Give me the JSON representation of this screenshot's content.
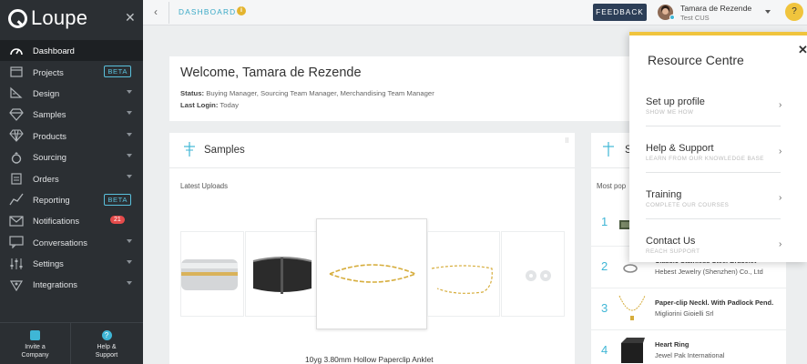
{
  "app": {
    "logo_text": "Loupe"
  },
  "sidebar": {
    "items": [
      {
        "label": "Dashboard",
        "icon": "dashboard-gauge-icon",
        "active": true
      },
      {
        "label": "Projects",
        "icon": "projects-icon",
        "badge": "BETA"
      },
      {
        "label": "Design",
        "icon": "design-ruler-icon"
      },
      {
        "label": "Samples",
        "icon": "diamond-icon"
      },
      {
        "label": "Products",
        "icon": "gem-icon"
      },
      {
        "label": "Sourcing",
        "icon": "ring-icon"
      },
      {
        "label": "Orders",
        "icon": "clipboard-icon"
      },
      {
        "label": "Reporting",
        "icon": "chart-line-icon",
        "badge": "BETA"
      },
      {
        "label": "Notifications",
        "icon": "envelope-icon",
        "count": "21"
      },
      {
        "label": "Conversations",
        "icon": "chat-icon"
      },
      {
        "label": "Settings",
        "icon": "sliders-icon"
      },
      {
        "label": "Integrations",
        "icon": "integrations-icon"
      }
    ],
    "bottom": {
      "invite_line1": "Invite a",
      "invite_line2": "Company",
      "help_line1": "Help &",
      "help_line2": "Support"
    }
  },
  "topbar": {
    "breadcrumb": "DASHBOARD",
    "feedback_label": "FEEDBACK",
    "user_name": "Tamara de Rezende",
    "user_org": "Test CUS",
    "help_glyph": "?"
  },
  "welcome": {
    "title": "Welcome, Tamara de Rezende",
    "status_label": "Status:",
    "status_value": "Buying Manager, Sourcing Team Manager, Merchandising Team Manager",
    "login_label": "Last Login:",
    "login_value": "Today"
  },
  "samples": {
    "title": "Samples",
    "latest_label": "Latest Uploads",
    "featured_name": "10yg 3.80mm Hollow Paperclip Anklet"
  },
  "popular": {
    "title_fragment": "S",
    "label_fragment": "Most pop",
    "items": [
      {
        "num": "1",
        "title": "",
        "sub": ""
      },
      {
        "num": "2",
        "title": "Classic Stainless Steel Bracelet",
        "sub": "Hebest Jewelry (Shenzhen) Co., Ltd"
      },
      {
        "num": "3",
        "title": "Paper-clip Neckl. With Padlock Pend.",
        "sub": "Migliorini Gioielli Srl"
      },
      {
        "num": "4",
        "title": "Heart Ring",
        "sub": "Jewel Pak International"
      }
    ]
  },
  "resource_centre": {
    "title": "Resource Centre",
    "items": [
      {
        "label": "Set up profile",
        "sub": "SHOW ME HOW"
      },
      {
        "label": "Help & Support",
        "sub": "LEARN FROM OUR KNOWLEDGE BASE"
      },
      {
        "label": "Training",
        "sub": "COMPLETE OUR COURSES"
      },
      {
        "label": "Contact Us",
        "sub": "REACH SUPPORT"
      }
    ]
  }
}
